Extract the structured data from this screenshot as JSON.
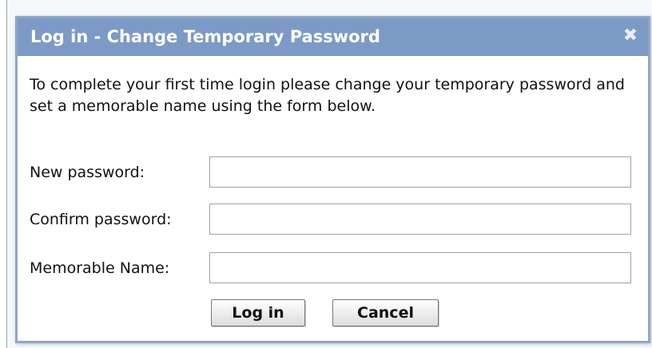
{
  "dialog": {
    "title": "Log in - Change Temporary Password",
    "close_glyph": "✖",
    "intro": "To complete your first time login please change your temporary password and set a memorable name using the form below."
  },
  "form": {
    "fields": [
      {
        "label": "New password:",
        "value": "",
        "type": "password"
      },
      {
        "label": "Confirm password:",
        "value": "",
        "type": "password"
      },
      {
        "label": "Memorable Name:",
        "value": "",
        "type": "text"
      }
    ]
  },
  "buttons": {
    "login_label": "Log in",
    "cancel_label": "Cancel"
  },
  "colors": {
    "titlebar": "#7c9ac6",
    "border": "#8ea6c8"
  },
  "icons": {
    "close": "close-icon"
  }
}
